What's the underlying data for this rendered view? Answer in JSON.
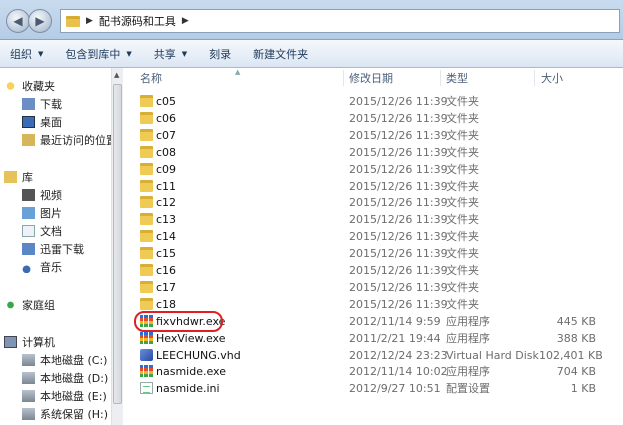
{
  "address_bar": {
    "path": "配书源码和工具"
  },
  "toolbar": {
    "organize": "组织",
    "include_library": "包含到库中",
    "share": "共享",
    "burn": "刻录",
    "new_folder": "新建文件夹"
  },
  "nav": {
    "favorites": "收藏夹",
    "downloads": "下载",
    "desktop": "桌面",
    "recent": "最近访问的位置",
    "libraries": "库",
    "videos": "视频",
    "pictures": "图片",
    "documents": "文档",
    "thunder": "迅雷下载",
    "music": "音乐",
    "homegroup": "家庭组",
    "computer": "计算机",
    "disk_c": "本地磁盘 (C:)",
    "disk_d": "本地磁盘 (D:)",
    "disk_e": "本地磁盘 (E:)",
    "disk_h": "系统保留 (H:)"
  },
  "columns": {
    "name": "名称",
    "date": "修改日期",
    "type": "类型",
    "size": "大小"
  },
  "files": [
    {
      "name": "c05",
      "date": "2015/12/26 11:39",
      "type": "文件夹",
      "size": "",
      "icon": "folder-icon"
    },
    {
      "name": "c06",
      "date": "2015/12/26 11:39",
      "type": "文件夹",
      "size": "",
      "icon": "folder-icon"
    },
    {
      "name": "c07",
      "date": "2015/12/26 11:39",
      "type": "文件夹",
      "size": "",
      "icon": "folder-icon"
    },
    {
      "name": "c08",
      "date": "2015/12/26 11:39",
      "type": "文件夹",
      "size": "",
      "icon": "folder-icon"
    },
    {
      "name": "c09",
      "date": "2015/12/26 11:39",
      "type": "文件夹",
      "size": "",
      "icon": "folder-icon"
    },
    {
      "name": "c11",
      "date": "2015/12/26 11:39",
      "type": "文件夹",
      "size": "",
      "icon": "folder-icon"
    },
    {
      "name": "c12",
      "date": "2015/12/26 11:39",
      "type": "文件夹",
      "size": "",
      "icon": "folder-icon"
    },
    {
      "name": "c13",
      "date": "2015/12/26 11:39",
      "type": "文件夹",
      "size": "",
      "icon": "folder-icon"
    },
    {
      "name": "c14",
      "date": "2015/12/26 11:39",
      "type": "文件夹",
      "size": "",
      "icon": "folder-icon"
    },
    {
      "name": "c15",
      "date": "2015/12/26 11:39",
      "type": "文件夹",
      "size": "",
      "icon": "folder-icon"
    },
    {
      "name": "c16",
      "date": "2015/12/26 11:39",
      "type": "文件夹",
      "size": "",
      "icon": "folder-icon"
    },
    {
      "name": "c17",
      "date": "2015/12/26 11:39",
      "type": "文件夹",
      "size": "",
      "icon": "folder-icon"
    },
    {
      "name": "c18",
      "date": "2015/12/26 11:39",
      "type": "文件夹",
      "size": "",
      "icon": "folder-icon"
    },
    {
      "name": "fixvhdwr.exe",
      "date": "2012/11/14 9:59",
      "type": "应用程序",
      "size": "445 KB",
      "icon": "exe-icon"
    },
    {
      "name": "HexView.exe",
      "date": "2011/2/21 19:44",
      "type": "应用程序",
      "size": "388 KB",
      "icon": "exe-icon"
    },
    {
      "name": "LEECHUNG.vhd",
      "date": "2012/12/24 23:23",
      "type": "Virtual Hard Disk",
      "size": "102,401 KB",
      "icon": "vhd-icon"
    },
    {
      "name": "nasmide.exe",
      "date": "2012/11/14 10:02",
      "type": "应用程序",
      "size": "704 KB",
      "icon": "exe-icon"
    },
    {
      "name": "nasmide.ini",
      "date": "2012/9/27 10:51",
      "type": "配置设置",
      "size": "1 KB",
      "icon": "ini-icon"
    }
  ],
  "colors": {
    "titlebar": "#c9dbee",
    "toolbar": "#dbe6f3",
    "highlight_circle": "#e02020",
    "folder": "#efcb56"
  }
}
